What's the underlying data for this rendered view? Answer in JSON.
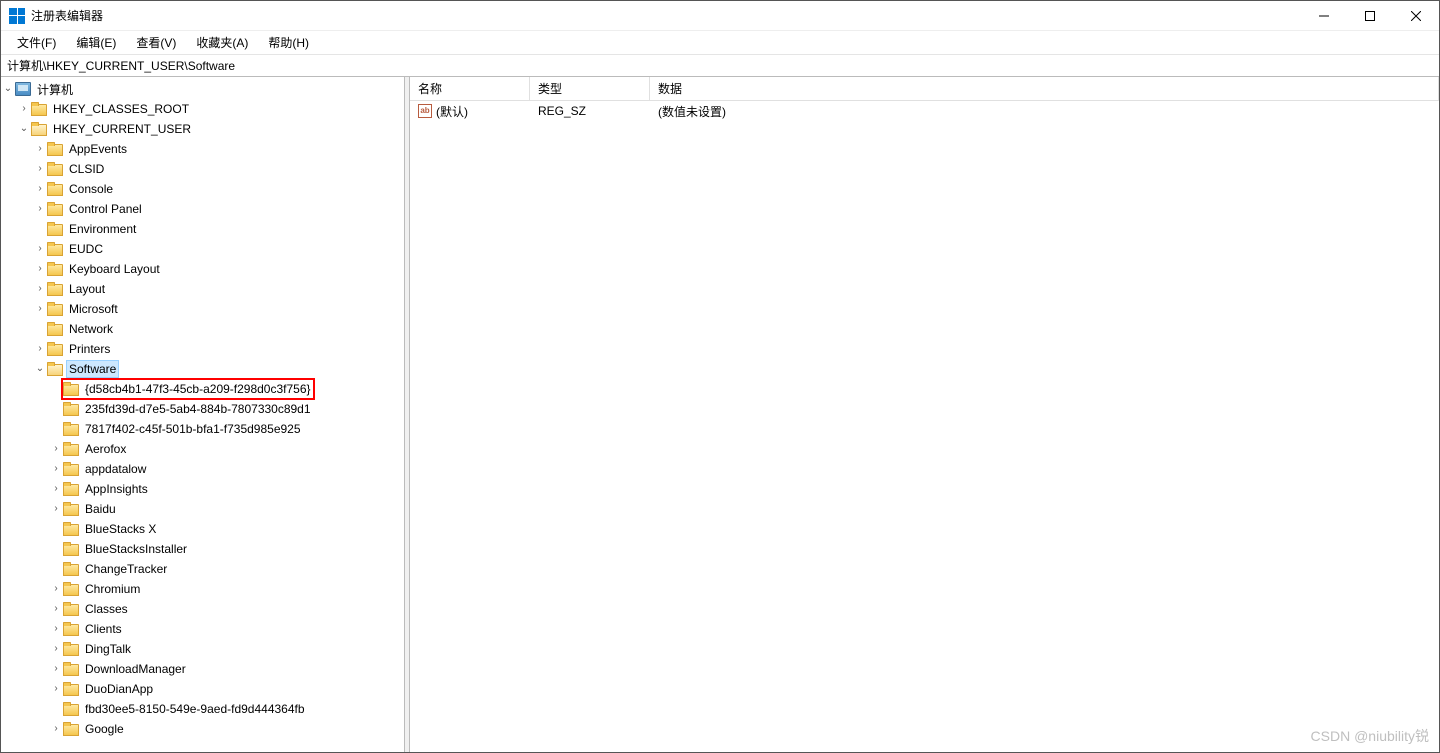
{
  "window": {
    "title": "注册表编辑器"
  },
  "menu": {
    "file": "文件(F)",
    "edit": "编辑(E)",
    "view": "查看(V)",
    "favorites": "收藏夹(A)",
    "help": "帮助(H)"
  },
  "address": {
    "path": "计算机\\HKEY_CURRENT_USER\\Software"
  },
  "columns": {
    "name": "名称",
    "type": "类型",
    "data": "数据"
  },
  "values": [
    {
      "name": "(默认)",
      "type": "REG_SZ",
      "data": "(数值未设置)"
    }
  ],
  "tree": {
    "root": "计算机",
    "hives": [
      {
        "name": "HKEY_CLASSES_ROOT",
        "depth": 1,
        "expandable": true,
        "expanded": false
      },
      {
        "name": "HKEY_CURRENT_USER",
        "depth": 1,
        "expandable": true,
        "expanded": true
      }
    ],
    "hkcu_children": [
      {
        "name": "AppEvents",
        "depth": 2,
        "expandable": true
      },
      {
        "name": "CLSID",
        "depth": 2,
        "expandable": true
      },
      {
        "name": "Console",
        "depth": 2,
        "expandable": true
      },
      {
        "name": "Control Panel",
        "depth": 2,
        "expandable": true
      },
      {
        "name": "Environment",
        "depth": 2,
        "expandable": false
      },
      {
        "name": "EUDC",
        "depth": 2,
        "expandable": true
      },
      {
        "name": "Keyboard Layout",
        "depth": 2,
        "expandable": true
      },
      {
        "name": "Layout",
        "depth": 2,
        "expandable": true
      },
      {
        "name": "Microsoft",
        "depth": 2,
        "expandable": true
      },
      {
        "name": "Network",
        "depth": 2,
        "expandable": false
      },
      {
        "name": "Printers",
        "depth": 2,
        "expandable": true
      },
      {
        "name": "Software",
        "depth": 2,
        "expandable": true,
        "expanded": true,
        "selected": true
      }
    ],
    "software_children": [
      {
        "name": "{d58cb4b1-47f3-45cb-a209-f298d0c3f756}",
        "depth": 3,
        "expandable": false,
        "highlighted": true
      },
      {
        "name": "235fd39d-d7e5-5ab4-884b-7807330c89d1",
        "depth": 3,
        "expandable": false
      },
      {
        "name": "7817f402-c45f-501b-bfa1-f735d985e925",
        "depth": 3,
        "expandable": false
      },
      {
        "name": "Aerofox",
        "depth": 3,
        "expandable": true
      },
      {
        "name": "appdatalow",
        "depth": 3,
        "expandable": true
      },
      {
        "name": "AppInsights",
        "depth": 3,
        "expandable": true
      },
      {
        "name": "Baidu",
        "depth": 3,
        "expandable": true
      },
      {
        "name": "BlueStacks X",
        "depth": 3,
        "expandable": false
      },
      {
        "name": "BlueStacksInstaller",
        "depth": 3,
        "expandable": false
      },
      {
        "name": "ChangeTracker",
        "depth": 3,
        "expandable": false
      },
      {
        "name": "Chromium",
        "depth": 3,
        "expandable": true
      },
      {
        "name": "Classes",
        "depth": 3,
        "expandable": true
      },
      {
        "name": "Clients",
        "depth": 3,
        "expandable": true
      },
      {
        "name": "DingTalk",
        "depth": 3,
        "expandable": true
      },
      {
        "name": "DownloadManager",
        "depth": 3,
        "expandable": true
      },
      {
        "name": "DuoDianApp",
        "depth": 3,
        "expandable": true
      },
      {
        "name": "fbd30ee5-8150-549e-9aed-fd9d444364fb",
        "depth": 3,
        "expandable": false
      },
      {
        "name": "Google",
        "depth": 3,
        "expandable": true
      }
    ]
  },
  "watermark": "CSDN @niubility锐"
}
